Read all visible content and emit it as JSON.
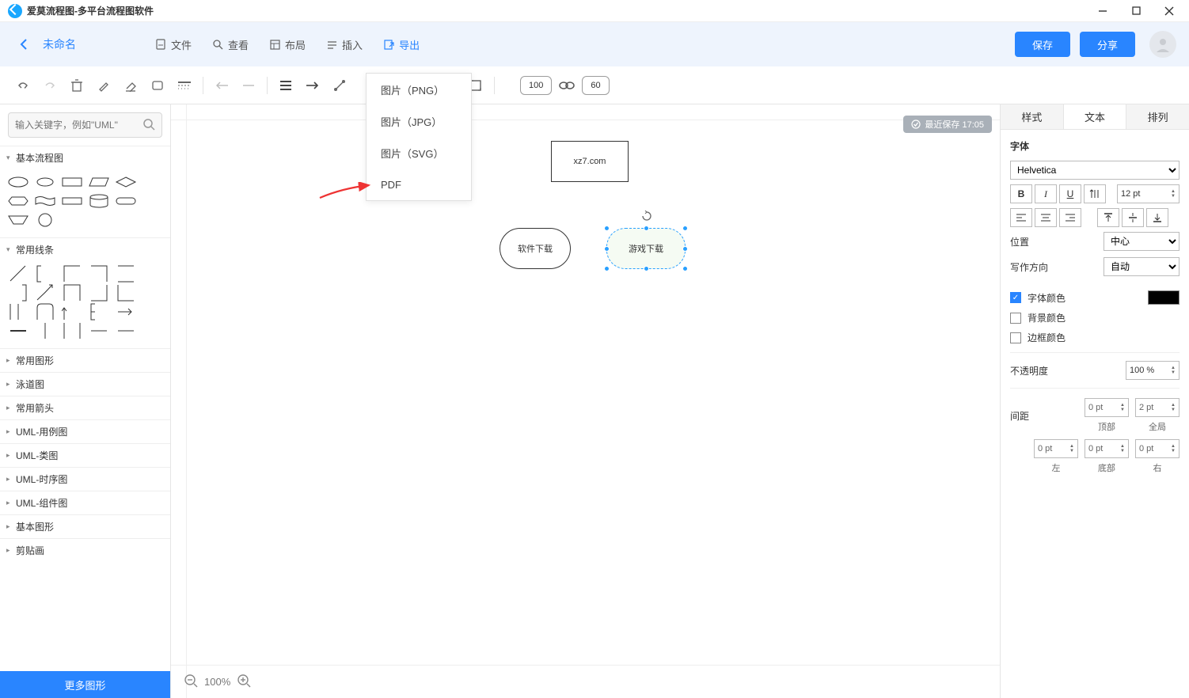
{
  "app_title": "爱莫流程图-多平台流程图软件",
  "doc_name": "未命名",
  "menu": {
    "file": "文件",
    "view": "查看",
    "layout": "布局",
    "insert": "插入",
    "export": "导出"
  },
  "header_buttons": {
    "save": "保存",
    "share": "分享"
  },
  "export_menu": {
    "png": "图片（PNG）",
    "jpg": "图片（JPG）",
    "svg": "图片（SVG）",
    "pdf": "PDF"
  },
  "search_placeholder": "输入关键字，例如\"UML\"",
  "sidebar": {
    "basic": "基本流程图",
    "lines": "常用线条",
    "common": "常用图形",
    "swim": "泳道图",
    "arrows": "常用箭头",
    "uml_use": "UML-用例图",
    "uml_class": "UML-类图",
    "uml_seq": "UML-时序图",
    "uml_comp": "UML-组件图",
    "basic_shape": "基本图形",
    "clip": "剪贴画",
    "more": "更多图形"
  },
  "toolbar": {
    "zoom1": "100",
    "zoom2": "60"
  },
  "canvas": {
    "top": "xz7.com",
    "left": "软件下载",
    "right": "游戏下载",
    "save_badge": "最近保存 17:05",
    "zoom_text": "100%"
  },
  "right": {
    "tab_style": "样式",
    "tab_text": "文本",
    "tab_arrange": "排列",
    "font_label": "字体",
    "font_family": "Helvetica",
    "font_size": "12 pt",
    "pos_label": "位置",
    "pos_value": "中心",
    "dir_label": "写作方向",
    "dir_value": "自动",
    "font_color": "字体颜色",
    "bg_color": "背景颜色",
    "border_color": "边框颜色",
    "opacity_label": "不透明度",
    "opacity_value": "100 %",
    "spacing_label": "间距",
    "top": "顶部",
    "global": "全局",
    "left": "左",
    "bottom": "底部",
    "right": "右",
    "sp_top": "0 pt",
    "sp_global": "2 pt",
    "sp_left": "0 pt",
    "sp_bottom": "0 pt",
    "sp_right": "0 pt"
  }
}
